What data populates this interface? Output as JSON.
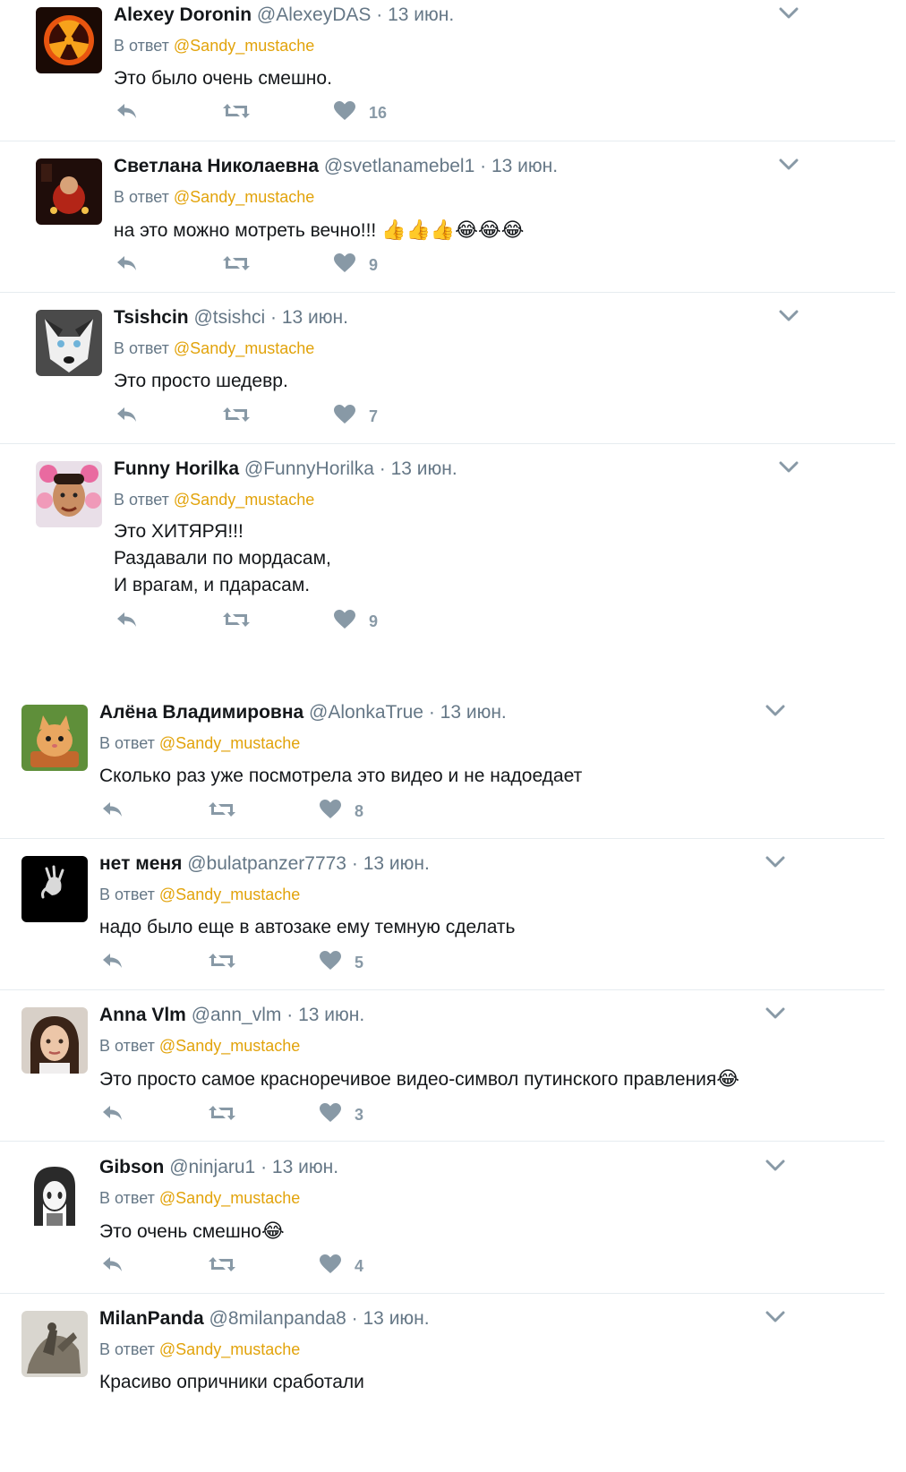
{
  "reply_label": "В ответ",
  "colors": {
    "name": "#14171a",
    "meta": "#657786",
    "mention": "#e2a30b",
    "icon": "#8899a6",
    "divider": "#e6ecf0"
  },
  "icons": {
    "reply": "reply-icon",
    "retweet": "retweet-icon",
    "like": "heart-icon",
    "menu": "chevron-down-icon"
  },
  "tweets": [
    {
      "name": "Alexey Doronin",
      "handle": "@AlexeyDAS",
      "time": "13 июн.",
      "mention": "@Sandy_mustache",
      "text": "Это было очень смешно.",
      "emoji": "",
      "likes": "16"
    },
    {
      "name": "Светлана Николаевна",
      "handle": "@svetlanamebel1",
      "time": "13 июн.",
      "mention": "@Sandy_mustache",
      "text": "на это можно мотреть вечно!!!",
      "emoji": "👍👍👍😂😂😂",
      "likes": "9"
    },
    {
      "name": "Tsishcin",
      "handle": "@tsishci",
      "time": "13 июн.",
      "mention": "@Sandy_mustache",
      "text": "Это просто шедевр.",
      "emoji": "",
      "likes": "7"
    },
    {
      "name": "Funny Horilka",
      "handle": "@FunnyHorilka",
      "time": "13 июн.",
      "mention": "@Sandy_mustache",
      "text": "Это ХИТЯРЯ!!!\nРаздавали по мордасам,\nИ врагам, и пдарасам.",
      "emoji": "",
      "likes": "9"
    },
    {
      "name": "Алёна Владимировна",
      "handle": "@AlonkaTrue",
      "time": "13 июн.",
      "mention": "@Sandy_mustache",
      "text": "Сколько раз уже посмотрела это видео и не надоедает",
      "emoji": "",
      "likes": "8"
    },
    {
      "name": "нет меня",
      "handle": "@bulatpanzer7773",
      "time": "13 июн.",
      "mention": "@Sandy_mustache",
      "text": "надо было еще в автозаке ему темную сделать",
      "emoji": "",
      "likes": "5"
    },
    {
      "name": "Anna Vlm",
      "handle": "@ann_vlm",
      "time": "13 июн.",
      "mention": "@Sandy_mustache",
      "text": "Это просто самое красноречивое видео-символ путинского правления",
      "emoji": "😂",
      "likes": "3"
    },
    {
      "name": "Gibson",
      "handle": "@ninjaru1",
      "time": "13 июн.",
      "mention": "@Sandy_mustache",
      "text": "Это очень смешно",
      "emoji": "😂",
      "likes": "4"
    },
    {
      "name": "MilanPanda",
      "handle": "@8milanpanda8",
      "time": "13 июн.",
      "mention": "@Sandy_mustache",
      "text": "Красиво опричники сработали",
      "emoji": "",
      "likes": ""
    }
  ]
}
